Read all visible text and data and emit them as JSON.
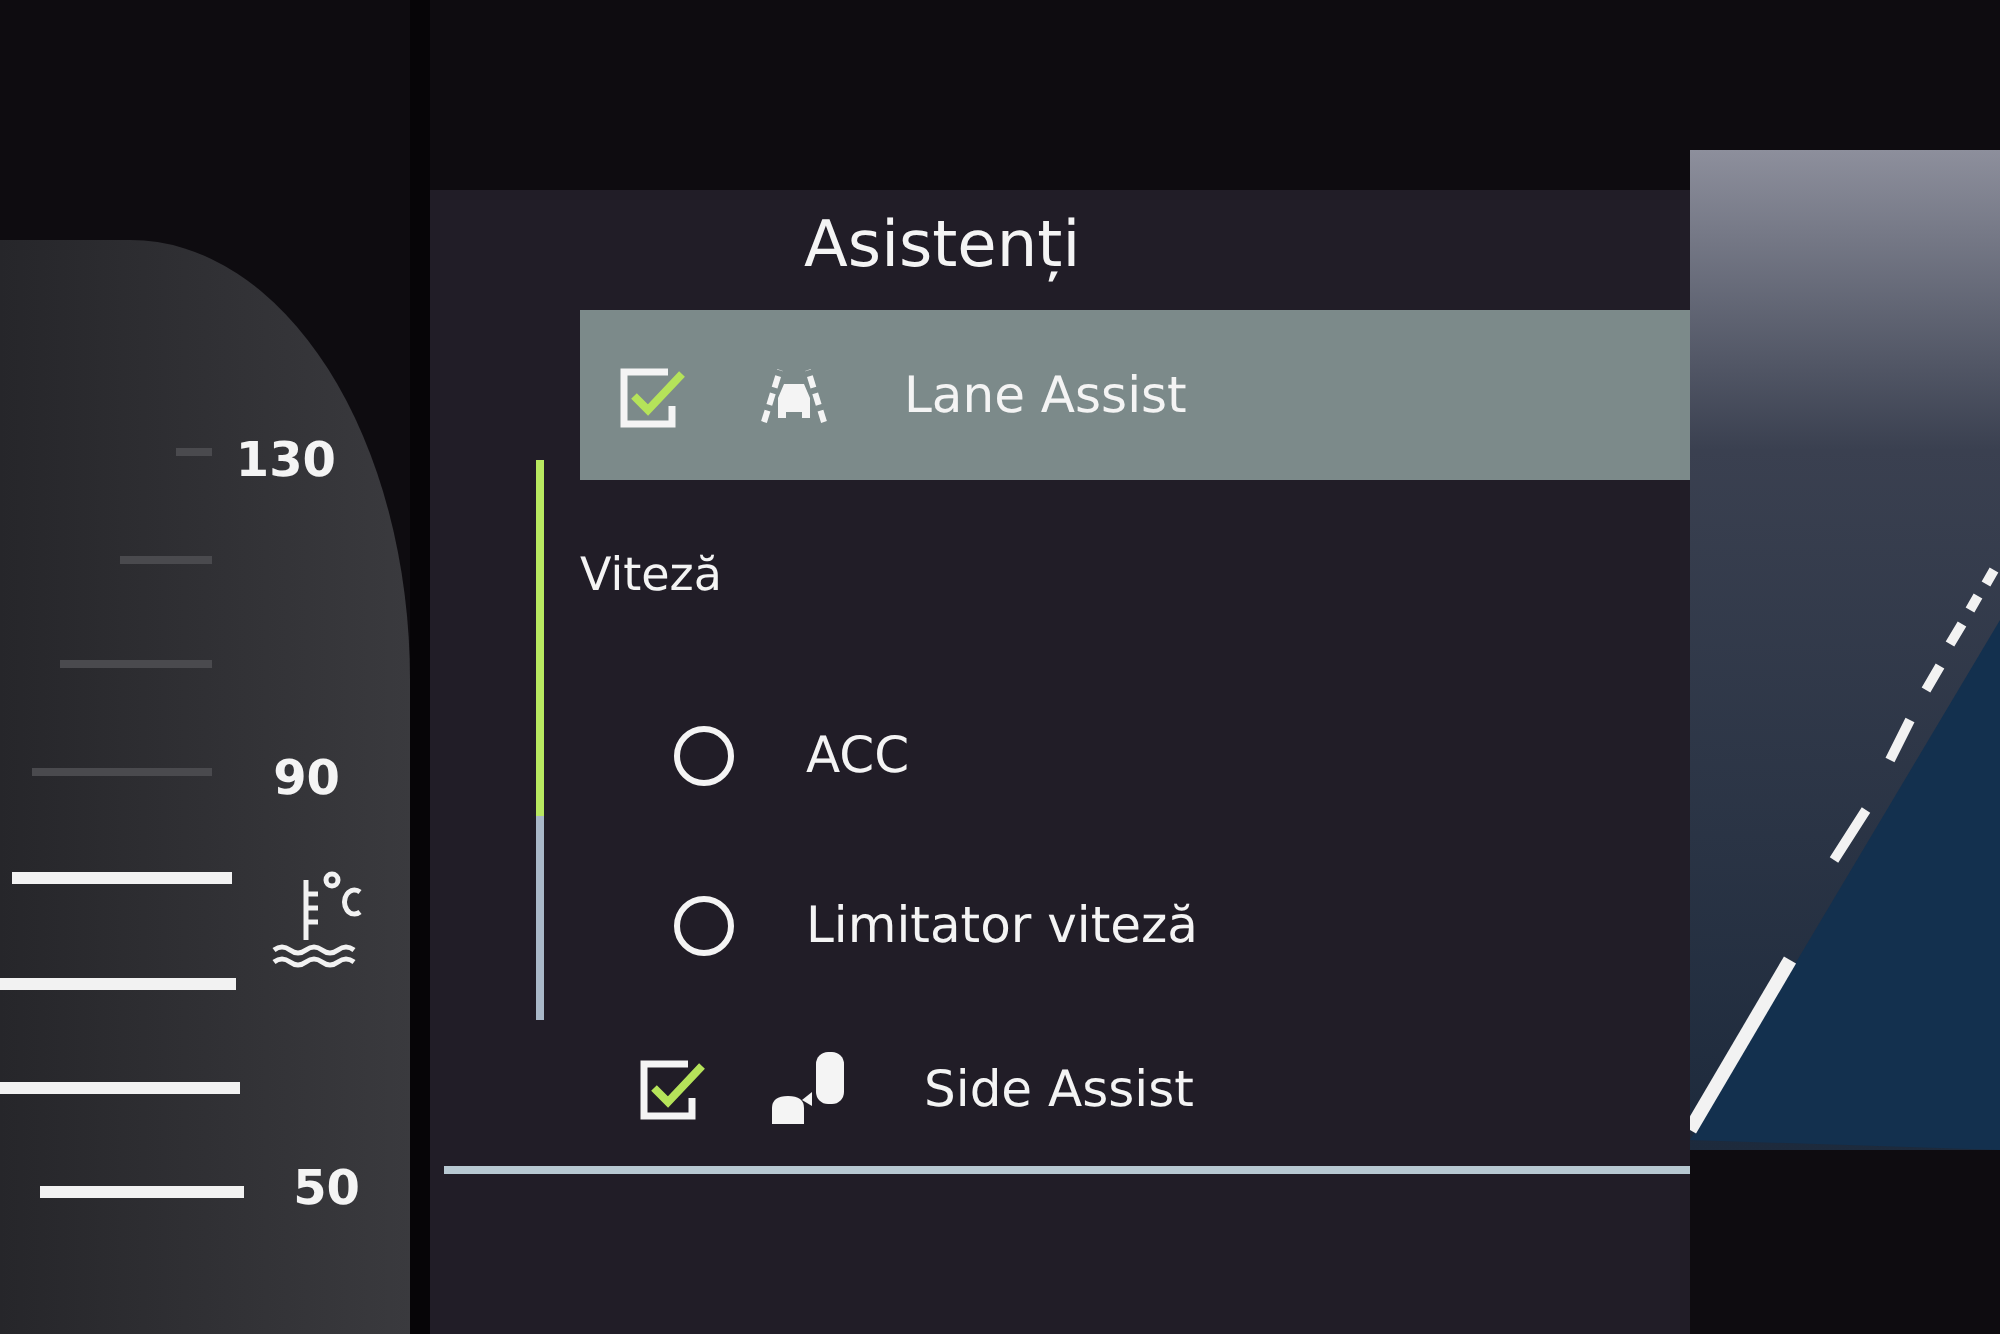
{
  "gauge": {
    "labels": [
      "130",
      "90",
      "50"
    ]
  },
  "menu": {
    "title": "Asistenți",
    "items": [
      {
        "kind": "checkbox",
        "label": "Lane Assist",
        "checked": true,
        "selected": true
      },
      {
        "kind": "header",
        "label": "Viteză"
      },
      {
        "kind": "radio",
        "label": "ACC",
        "checked": false,
        "selected": false
      },
      {
        "kind": "radio",
        "label": "Limitator viteză",
        "checked": false,
        "selected": false
      },
      {
        "kind": "checkbox",
        "label": "Side Assist",
        "checked": true,
        "selected": false
      }
    ]
  }
}
